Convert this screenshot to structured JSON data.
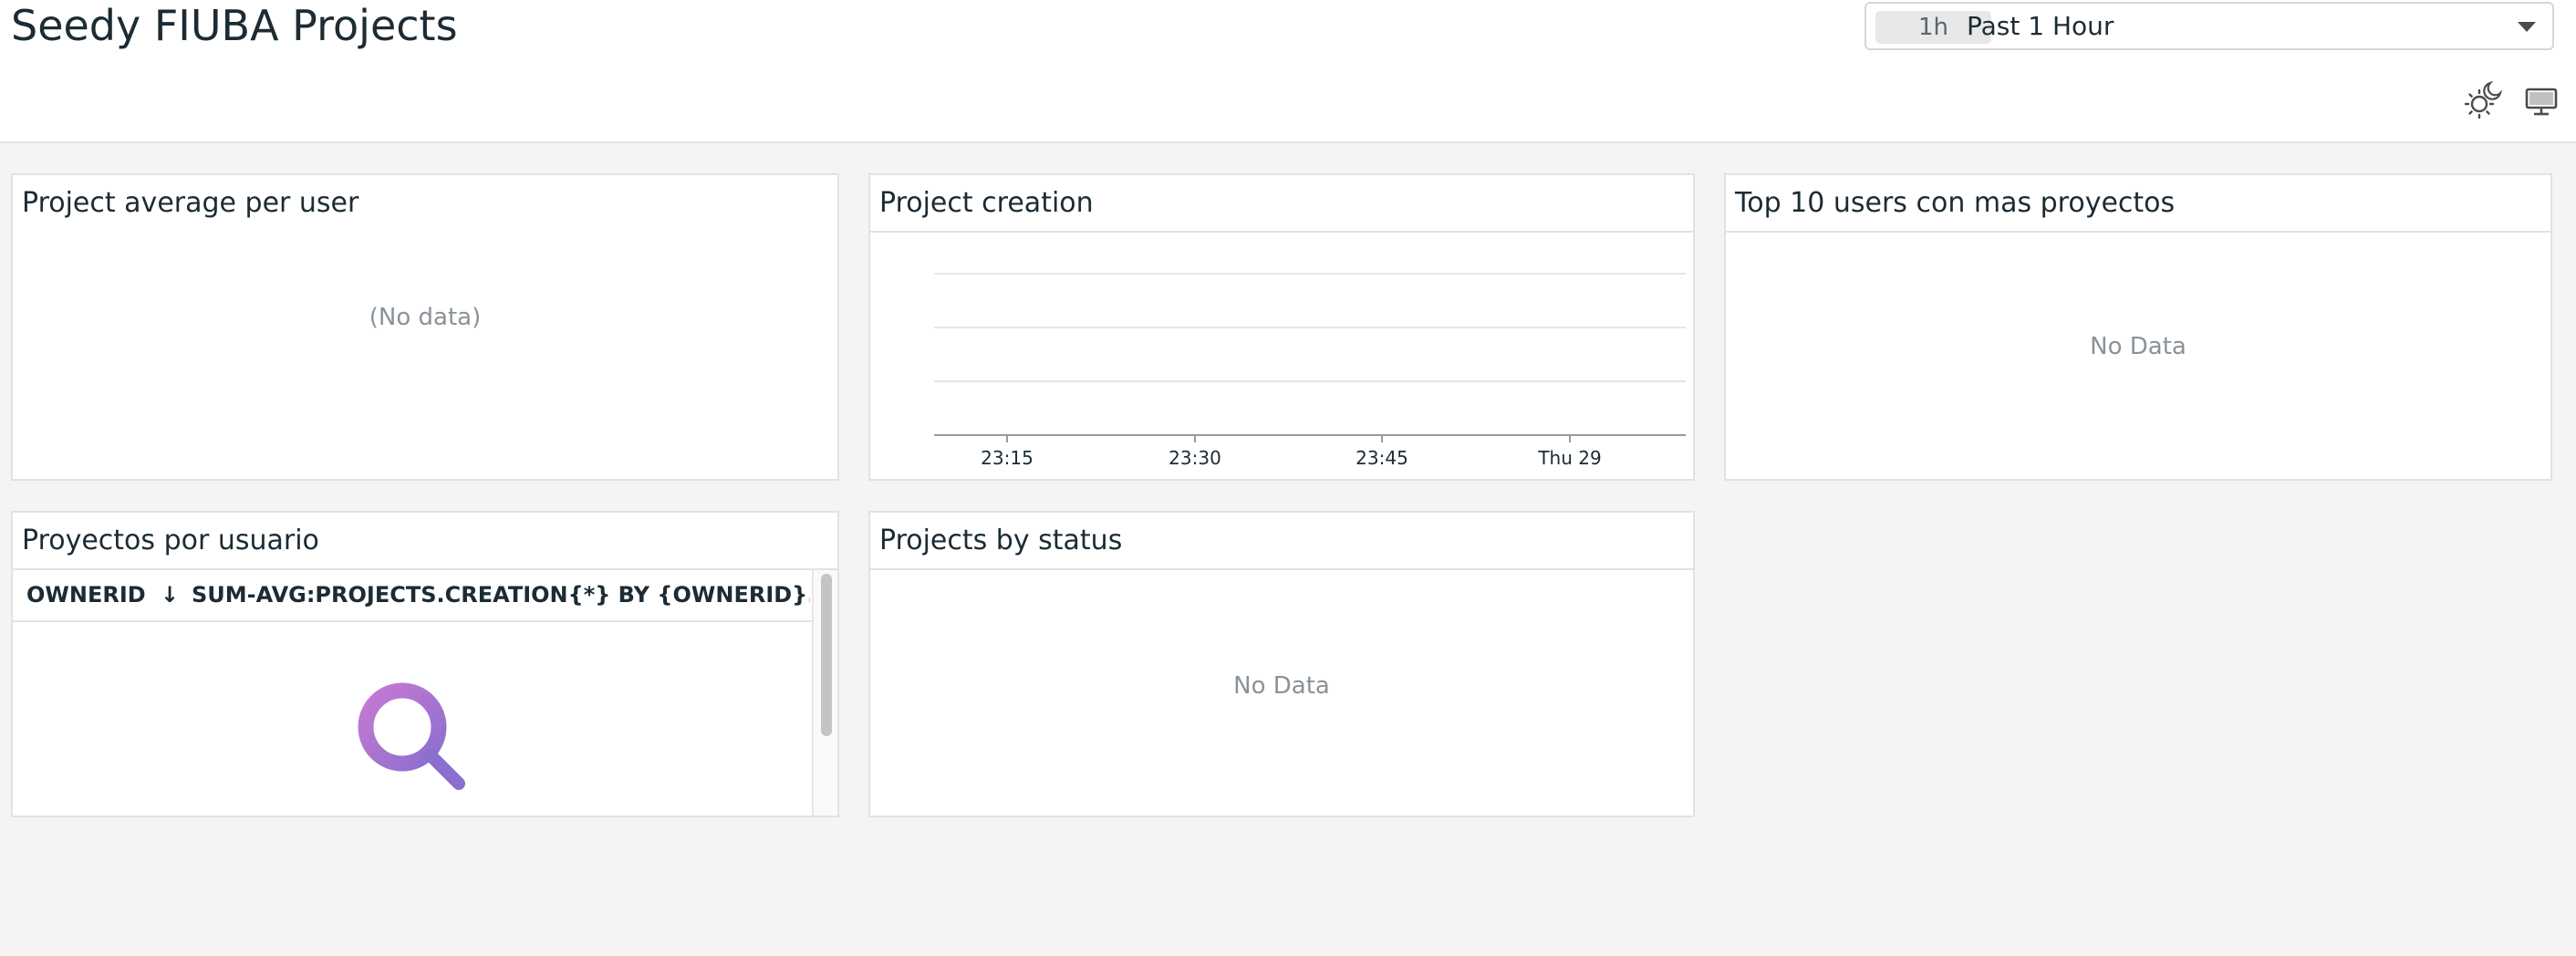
{
  "header": {
    "title": "Seedy FIUBA Projects",
    "timepicker": {
      "badge": "1h",
      "label": "Past 1 Hour"
    },
    "icons": {
      "theme": "sun-moon-icon",
      "tv_mode": "monitor-icon"
    }
  },
  "widgets": {
    "avg_per_user": {
      "title": "Project average per user",
      "empty_text": "(No data)"
    },
    "project_creation": {
      "title": "Project creation"
    },
    "top_users": {
      "title": "Top 10 users con mas proyectos",
      "empty_text": "No Data"
    },
    "por_usuario": {
      "title": "Proyectos por usuario",
      "columns": [
        "OWNERID",
        "SUM-AVG:PROJECTS.CREATION{*} BY {OWNERID}.AS_C..."
      ],
      "sort_icon": "arrow-down-icon",
      "empty_icon": "search-icon"
    },
    "by_status": {
      "title": "Projects by status",
      "empty_text": "No Data"
    }
  },
  "chart_data": {
    "type": "line",
    "title": "Project creation",
    "x_ticks": [
      "23:15",
      "23:30",
      "23:45",
      "Thu 29"
    ],
    "series": [],
    "grid": true
  },
  "colors": {
    "background": "#f4f4f4",
    "widget_border": "#e2e2e2",
    "text": "#1c2b34",
    "muted": "#8a9299",
    "search_gradient_start": "#c679d2",
    "search_gradient_end": "#8b6fcf"
  }
}
